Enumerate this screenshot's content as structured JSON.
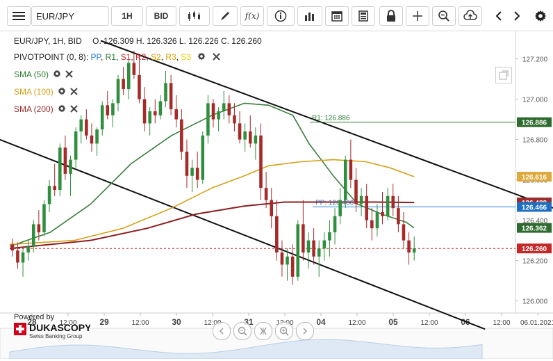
{
  "toolbar": {
    "symbol": "EUR/JPY",
    "period": "1H",
    "side": "BID",
    "icons": [
      "hamburger-menu-icon",
      "candles-icon",
      "pencil-icon",
      "function-icon",
      "info-icon",
      "bars-icon",
      "calendar-icon",
      "news-icon",
      "lock-icon",
      "crosshair-icon",
      "zoom-icon",
      "upload-icon",
      "arrow-left-icon",
      "arrow-right-icon",
      "gear-icon"
    ]
  },
  "header": {
    "instrument": "EUR/JPY, 1H, BID",
    "ohlc": "O. 126.309 H. 126.326 L. 126.226 C. 126.260"
  },
  "legend": {
    "pivot_name": "PIVOTPOINT (0, 8)",
    "pivot_parts": [
      {
        "label": "PP",
        "color": "#1e7ad6"
      },
      {
        "label": "R1",
        "color": "#2e7d32"
      },
      {
        "label": "S1",
        "color": "#c62828"
      },
      {
        "label": "R2",
        "color": "#c62828"
      },
      {
        "label": "S2",
        "color": "#e0a000"
      },
      {
        "label": "R3",
        "color": "#e0a000"
      },
      {
        "label": "S3",
        "color": "#f2d000"
      }
    ],
    "sma": [
      {
        "label": "SMA (50)",
        "color": "#2e7d32"
      },
      {
        "label": "SMA (100)",
        "color": "#d4a017"
      },
      {
        "label": "SMA (200)",
        "color": "#9b2c2c"
      }
    ]
  },
  "branding": {
    "powered_by": "Powered by",
    "name": "DUKASCOPY",
    "tagline": "Swiss Banking Group"
  },
  "chart_data": {
    "type": "candlestick",
    "y_ticks": [
      "127.200",
      "127.000",
      "126.800",
      "126.600",
      "126.400",
      "126.200",
      "126.000"
    ],
    "ylim": [
      125.94,
      127.34
    ],
    "x_ticks": [
      {
        "label": "28",
        "bold": true
      },
      {
        "label": "12:00",
        "bold": false
      },
      {
        "label": "29",
        "bold": true
      },
      {
        "label": "12:00",
        "bold": false
      },
      {
        "label": "30",
        "bold": true
      },
      {
        "label": "12:00",
        "bold": false
      },
      {
        "label": "31",
        "bold": true
      },
      {
        "label": "12:00",
        "bold": false
      },
      {
        "label": "04",
        "bold": true
      },
      {
        "label": "12:00",
        "bold": false
      },
      {
        "label": "05",
        "bold": true
      },
      {
        "label": "12:00",
        "bold": false
      },
      {
        "label": "06",
        "bold": true
      },
      {
        "label": "12:00",
        "bold": false
      },
      {
        "label": "06.01.2021",
        "bold": false
      }
    ],
    "pivot_lines": [
      {
        "name": "R1",
        "value": 126.886,
        "label": "R1: 126.886",
        "color": "#2e7d32"
      },
      {
        "name": "PP",
        "value": 126.466,
        "label": "PP: 126.466",
        "color": "#1e7ad6"
      }
    ],
    "price_tags": [
      {
        "value": 126.886,
        "text": "126.886",
        "bg": "#2e6b2e"
      },
      {
        "value": 126.616,
        "text": "126.616",
        "bg": "#e0a93b"
      },
      {
        "value": 126.488,
        "text": "126.488",
        "bg": "#9b2c2c"
      },
      {
        "value": 126.466,
        "text": "126.466",
        "bg": "#1e6fc4"
      },
      {
        "value": 126.362,
        "text": "126.362",
        "bg": "#2e6b2e"
      },
      {
        "value": 126.26,
        "text": "126.260",
        "bg": "#c62828"
      }
    ],
    "last_price": 126.26,
    "sma50": [
      [
        0,
        126.27
      ],
      [
        10,
        126.34
      ],
      [
        20,
        126.48
      ],
      [
        30,
        126.68
      ],
      [
        40,
        126.82
      ],
      [
        50,
        126.92
      ],
      [
        58,
        126.98
      ],
      [
        64,
        126.97
      ],
      [
        70,
        126.92
      ],
      [
        74,
        126.78
      ],
      [
        80,
        126.62
      ],
      [
        86,
        126.48
      ],
      [
        92,
        126.43
      ],
      [
        98,
        126.39
      ],
      [
        100,
        126.362
      ]
    ],
    "sma100": [
      [
        0,
        126.28
      ],
      [
        16,
        126.3
      ],
      [
        28,
        126.36
      ],
      [
        40,
        126.46
      ],
      [
        50,
        126.56
      ],
      [
        58,
        126.62
      ],
      [
        64,
        126.67
      ],
      [
        72,
        126.69
      ],
      [
        80,
        126.7
      ],
      [
        88,
        126.69
      ],
      [
        94,
        126.66
      ],
      [
        100,
        126.616
      ]
    ],
    "sma200": [
      [
        0,
        126.26
      ],
      [
        20,
        126.3
      ],
      [
        34,
        126.36
      ],
      [
        46,
        126.43
      ],
      [
        58,
        126.47
      ],
      [
        68,
        126.49
      ],
      [
        80,
        126.49
      ],
      [
        90,
        126.49
      ],
      [
        100,
        126.488
      ]
    ],
    "channel_lines": [
      {
        "name": "upper",
        "from": [
          18,
          127.29
        ],
        "to": [
          118,
          126.362
        ]
      },
      {
        "name": "lower",
        "from": [
          -2,
          126.8
        ],
        "to": [
          94,
          125.86
        ]
      }
    ],
    "candles": [
      [
        126.28,
        126.31,
        126.22,
        126.25
      ],
      [
        126.25,
        126.29,
        126.16,
        126.19
      ],
      [
        126.19,
        126.26,
        126.12,
        126.24
      ],
      [
        126.24,
        126.3,
        126.2,
        126.27
      ],
      [
        126.27,
        126.4,
        126.24,
        126.38
      ],
      [
        126.38,
        126.45,
        126.3,
        126.34
      ],
      [
        126.34,
        126.5,
        126.32,
        126.48
      ],
      [
        126.48,
        126.6,
        126.44,
        126.57
      ],
      [
        126.57,
        126.68,
        126.52,
        126.55
      ],
      [
        126.55,
        126.78,
        126.52,
        126.76
      ],
      [
        126.76,
        126.82,
        126.6,
        126.63
      ],
      [
        126.63,
        126.72,
        126.52,
        126.7
      ],
      [
        126.7,
        126.86,
        126.66,
        126.84
      ],
      [
        126.84,
        126.92,
        126.78,
        126.9
      ],
      [
        126.9,
        126.95,
        126.8,
        126.82
      ],
      [
        126.82,
        126.88,
        126.74,
        126.78
      ],
      [
        126.78,
        126.86,
        126.72,
        126.85
      ],
      [
        126.85,
        126.99,
        126.82,
        126.97
      ],
      [
        126.97,
        127.04,
        126.9,
        126.92
      ],
      [
        126.92,
        127.0,
        126.86,
        126.98
      ],
      [
        126.98,
        127.12,
        126.94,
        127.1
      ],
      [
        127.1,
        127.16,
        127.02,
        127.05
      ],
      [
        127.05,
        127.2,
        127.0,
        127.18
      ],
      [
        127.18,
        127.24,
        127.1,
        127.12
      ],
      [
        127.12,
        127.22,
        126.98,
        127.0
      ],
      [
        127.0,
        127.06,
        126.84,
        126.88
      ],
      [
        126.88,
        126.96,
        126.82,
        126.94
      ],
      [
        126.94,
        127.0,
        126.88,
        126.92
      ],
      [
        126.92,
        127.02,
        126.9,
        126.99
      ],
      [
        126.99,
        127.14,
        126.96,
        127.08
      ],
      [
        127.08,
        127.12,
        126.92,
        126.95
      ],
      [
        126.95,
        127.02,
        126.86,
        126.9
      ],
      [
        126.9,
        126.95,
        126.7,
        126.74
      ],
      [
        126.74,
        126.8,
        126.56,
        126.62
      ],
      [
        126.62,
        126.7,
        126.54,
        126.66
      ],
      [
        126.66,
        126.74,
        126.56,
        126.6
      ],
      [
        126.6,
        126.84,
        126.58,
        126.82
      ],
      [
        126.82,
        127.02,
        126.78,
        126.98
      ],
      [
        126.98,
        127.0,
        126.86,
        126.9
      ],
      [
        126.9,
        126.96,
        126.84,
        126.94
      ],
      [
        126.94,
        127.04,
        126.9,
        126.98
      ],
      [
        126.98,
        127.02,
        126.88,
        126.92
      ],
      [
        126.92,
        126.98,
        126.84,
        126.88
      ],
      [
        126.88,
        126.94,
        126.78,
        126.8
      ],
      [
        126.8,
        126.88,
        126.74,
        126.84
      ],
      [
        126.84,
        126.92,
        126.76,
        126.78
      ],
      [
        126.78,
        126.86,
        126.7,
        126.82
      ],
      [
        126.82,
        126.88,
        126.5,
        126.56
      ],
      [
        126.56,
        126.64,
        126.46,
        126.5
      ],
      [
        126.5,
        126.56,
        126.36,
        126.42
      ],
      [
        126.42,
        126.5,
        126.2,
        126.24
      ],
      [
        126.24,
        126.3,
        126.12,
        126.18
      ],
      [
        126.18,
        126.26,
        126.1,
        126.22
      ],
      [
        126.22,
        126.28,
        126.08,
        126.12
      ],
      [
        126.12,
        126.4,
        126.1,
        126.38
      ],
      [
        126.38,
        126.5,
        126.2,
        126.24
      ],
      [
        126.24,
        126.34,
        126.16,
        126.3
      ],
      [
        126.3,
        126.36,
        126.18,
        126.22
      ],
      [
        126.22,
        126.3,
        126.12,
        126.26
      ],
      [
        126.26,
        126.34,
        126.2,
        126.3
      ],
      [
        126.3,
        126.4,
        126.22,
        126.34
      ],
      [
        126.34,
        126.46,
        126.28,
        126.42
      ],
      [
        126.42,
        126.56,
        126.38,
        126.5
      ],
      [
        126.5,
        126.72,
        126.46,
        126.7
      ],
      [
        126.7,
        126.8,
        126.56,
        126.6
      ],
      [
        126.6,
        126.66,
        126.44,
        126.48
      ],
      [
        126.48,
        126.56,
        126.42,
        126.52
      ],
      [
        126.52,
        126.58,
        126.36,
        126.4
      ],
      [
        126.4,
        126.46,
        126.3,
        126.36
      ],
      [
        126.36,
        126.48,
        126.32,
        126.44
      ],
      [
        126.44,
        126.54,
        126.38,
        126.42
      ],
      [
        126.42,
        126.56,
        126.4,
        126.52
      ],
      [
        126.52,
        126.58,
        126.42,
        126.46
      ],
      [
        126.46,
        126.52,
        126.34,
        126.38
      ],
      [
        126.38,
        126.44,
        126.26,
        126.3
      ],
      [
        126.3,
        126.34,
        126.18,
        126.24
      ],
      [
        126.24,
        126.32,
        126.2,
        126.26
      ]
    ]
  }
}
